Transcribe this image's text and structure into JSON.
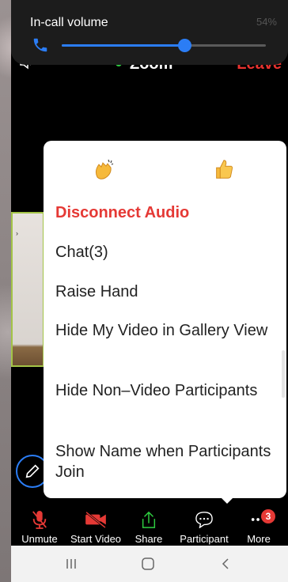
{
  "volume_overlay": {
    "title": "In-call volume",
    "status_text": "54%",
    "level": 0.6,
    "accent": "#2b7df5"
  },
  "meeting_bar": {
    "title": "Zoom",
    "leave_label": "Leave",
    "leave_color": "#e8322f"
  },
  "menu": {
    "reactions": [
      "clapping-hands-icon",
      "thumbs-up-icon"
    ],
    "items": [
      {
        "label": "Disconnect Audio",
        "danger": true
      },
      {
        "label": "Chat(3)"
      },
      {
        "label": "Raise Hand"
      },
      {
        "label": "Hide My Video in Gallery View"
      },
      {
        "label": "Hide Non–Video Participants"
      },
      {
        "label": "Show Name when Participants Join"
      }
    ]
  },
  "toolbar": {
    "unmute_label": "Unmute",
    "start_video_label": "Start Video",
    "share_label": "Share",
    "participant_label": "Participant",
    "more_label": "More",
    "more_badge": "3",
    "alert_color": "#e53935",
    "share_color": "#2ecc40"
  },
  "navbar": {
    "buttons": [
      "recent-apps-icon",
      "home-icon",
      "back-icon"
    ]
  }
}
